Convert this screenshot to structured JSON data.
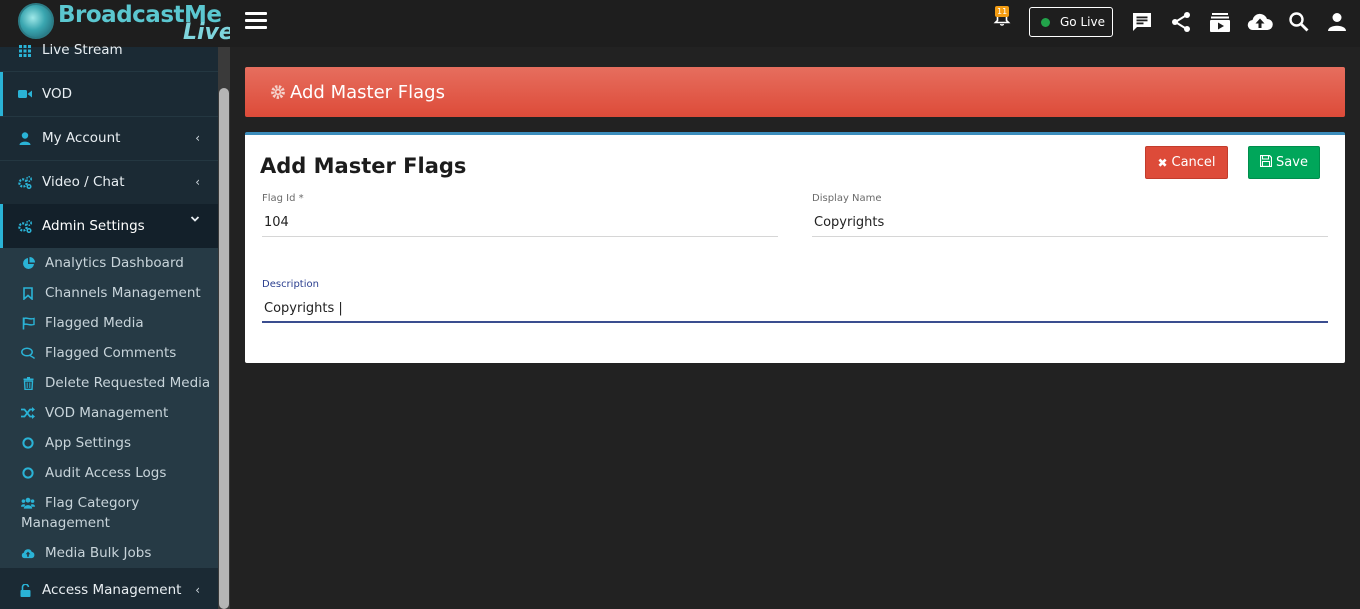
{
  "brand": {
    "name_part1": "BroadcastMe",
    "name_part2": "Live"
  },
  "sidebar": {
    "items": [
      {
        "label": "Live Stream",
        "icon": "grid-icon"
      },
      {
        "label": "VOD",
        "icon": "video-camera-icon"
      },
      {
        "label": "My Account",
        "icon": "user-icon",
        "chevron": "‹"
      },
      {
        "label": "Video / Chat",
        "icon": "cogs-icon",
        "chevron": "‹"
      },
      {
        "label": "Admin Settings",
        "icon": "cogs-icon",
        "chevron": "⌄"
      },
      {
        "label": "Access Management",
        "icon": "unlock-icon",
        "chevron": "‹"
      }
    ],
    "admin_sub": [
      {
        "label": "Analytics Dashboard",
        "icon": "pie-chart-icon"
      },
      {
        "label": "Channels Management",
        "icon": "bookmark-icon"
      },
      {
        "label": "Flagged Media",
        "icon": "flag-icon"
      },
      {
        "label": "Flagged Comments",
        "icon": "comments-icon"
      },
      {
        "label": "Delete Requested Media",
        "icon": "trash-icon"
      },
      {
        "label": "VOD Management",
        "icon": "shuffle-icon"
      },
      {
        "label": "App Settings",
        "icon": "circle-icon"
      },
      {
        "label": "Audit Access Logs",
        "icon": "circle-icon"
      },
      {
        "label": "Flag Category",
        "label2": "Management",
        "icon": "users-icon"
      },
      {
        "label": "Media Bulk Jobs",
        "icon": "cloud-upload-icon"
      }
    ]
  },
  "topbar": {
    "notifications_count": "11",
    "go_live_label": "Go Live"
  },
  "page": {
    "banner_title": "Add Master Flags",
    "card_title": "Add Master Flags",
    "cancel_label": "Cancel",
    "save_label": "Save",
    "fields": {
      "flag_id": {
        "label": "Flag Id *",
        "value": "104"
      },
      "display_name": {
        "label": "Display Name",
        "value": "Copyrights"
      },
      "description": {
        "label": "Description",
        "value": "Copyrights |"
      }
    }
  },
  "colors": {
    "accent": "#2ab3d6",
    "banner_red": "#dd4b39",
    "cancel_red": "#dd4b39",
    "save_green": "#00a65a",
    "card_border_blue": "#3c8dbc",
    "go_live_dot": "#22a34a",
    "badge_orange": "#f39c12"
  }
}
